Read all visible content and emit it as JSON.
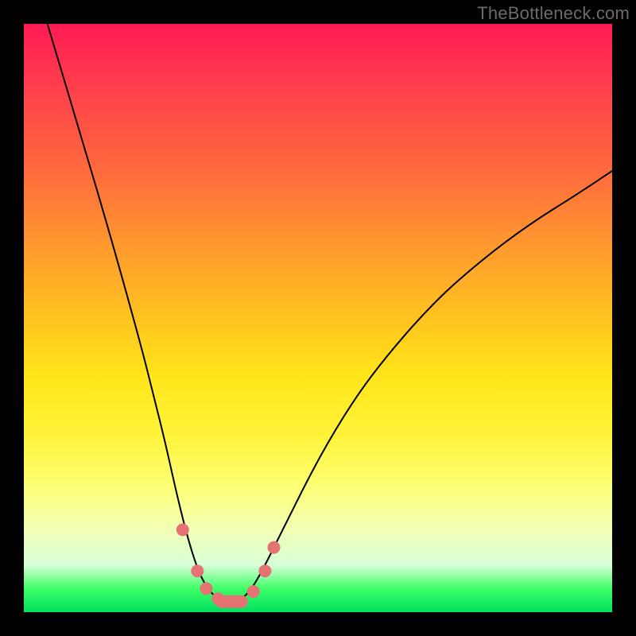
{
  "watermark": "TheBottleneck.com",
  "colors": {
    "frame": "#000000",
    "curve": "#000000",
    "marker": "#e57373",
    "gradient_top": "#ff1a53",
    "gradient_bottom": "#00e060"
  },
  "chart_data": {
    "type": "line",
    "title": "",
    "xlabel": "",
    "ylabel": "",
    "xlim": [
      0,
      100
    ],
    "ylim": [
      0,
      100
    ],
    "series": [
      {
        "name": "bottleneck-curve",
        "x": [
          4,
          10,
          15,
          20,
          22,
          24,
          26,
          28,
          30,
          32,
          34,
          36,
          38,
          40,
          44,
          50,
          56,
          62,
          70,
          78,
          86,
          94,
          100
        ],
        "y": [
          100,
          80,
          63,
          45,
          37,
          29,
          20,
          12,
          6,
          3,
          1.5,
          1.5,
          3,
          6,
          14,
          26,
          36,
          44,
          53,
          60,
          66,
          71,
          75
        ]
      }
    ],
    "markers": {
      "name": "highlighted-points",
      "x": [
        27,
        29.5,
        31,
        33,
        35,
        37,
        39,
        41,
        42.5
      ],
      "y": [
        14,
        7,
        4,
        2.3,
        1.8,
        1.8,
        3.5,
        7,
        11
      ]
    }
  }
}
